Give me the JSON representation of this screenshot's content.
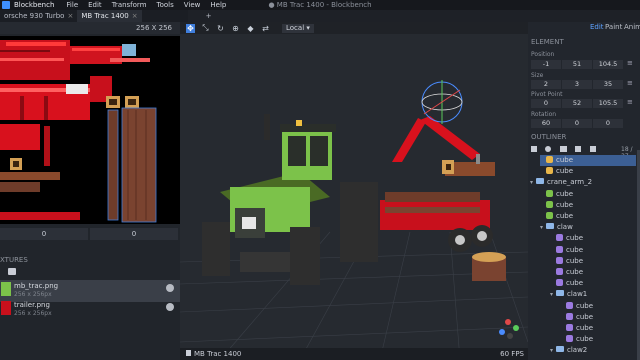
{
  "menubar": {
    "app": "Blockbench",
    "items": [
      "File",
      "Edit",
      "Transform",
      "Tools",
      "View",
      "Help"
    ],
    "window_title": "● MB Trac 1400 - Blockbench"
  },
  "tabs": [
    {
      "label": "orsche 930 Turbo",
      "close": "×"
    },
    {
      "label": "MB Trac 1400",
      "close": "×"
    },
    {
      "label": "+"
    }
  ],
  "uv": {
    "size_label": "256 X 256",
    "fields": [
      "0",
      "0"
    ]
  },
  "textures": {
    "header": "XTURES",
    "items": [
      {
        "name": "mb_trac.png",
        "resolution": "256 x 256px"
      },
      {
        "name": "trailer.png",
        "resolution": "256 x 256px"
      }
    ]
  },
  "viewport": {
    "space_select": "Local",
    "footer_left": "MB Trac 1400",
    "footer_right": "60 FPS"
  },
  "mode_tabs": [
    "Edit",
    "Paint",
    "Anim"
  ],
  "element": {
    "header": "ELEMENT",
    "position_label": "Position",
    "position": [
      "-1",
      "51",
      "104.5"
    ],
    "size_label": "Size",
    "size": [
      "2",
      "3",
      "35"
    ],
    "pivot_label": "Pivot Point",
    "pivot": [
      "0",
      "52",
      "105.5"
    ],
    "rotation_label": "Rotation",
    "rotation": [
      "60",
      "0",
      "0"
    ]
  },
  "outliner": {
    "header": "OUTLINER",
    "count": "18 / 37",
    "rows": [
      {
        "type": "cube",
        "label": "cube",
        "indent": 1
      },
      {
        "type": "cube",
        "label": "cube",
        "indent": 1
      },
      {
        "type": "group",
        "label": "crane_arm_2",
        "indent": 0
      },
      {
        "type": "cube",
        "label": "cube",
        "indent": 1
      },
      {
        "type": "cube",
        "label": "cube",
        "indent": 1
      },
      {
        "type": "cube",
        "label": "cube",
        "indent": 1
      },
      {
        "type": "group",
        "label": "claw",
        "indent": 1
      },
      {
        "type": "cube",
        "label": "cube",
        "indent": 2
      },
      {
        "type": "cube",
        "label": "cube",
        "indent": 2
      },
      {
        "type": "cube",
        "label": "cube",
        "indent": 2
      },
      {
        "type": "cube",
        "label": "cube",
        "indent": 2
      },
      {
        "type": "cube",
        "label": "cube",
        "indent": 2
      },
      {
        "type": "group",
        "label": "claw1",
        "indent": 2
      },
      {
        "type": "cube",
        "label": "cube",
        "indent": 3
      },
      {
        "type": "cube",
        "label": "cube",
        "indent": 3
      },
      {
        "type": "cube",
        "label": "cube",
        "indent": 3
      },
      {
        "type": "cube",
        "label": "cube",
        "indent": 3
      },
      {
        "type": "group",
        "label": "claw2",
        "indent": 2
      }
    ]
  },
  "colors": {
    "accent": "#3e90ff",
    "cube_yellow": "#e8b64a",
    "cube_green": "#7cc24a",
    "cube_purple": "#9b7ae0",
    "selection": "#3c5f94"
  }
}
